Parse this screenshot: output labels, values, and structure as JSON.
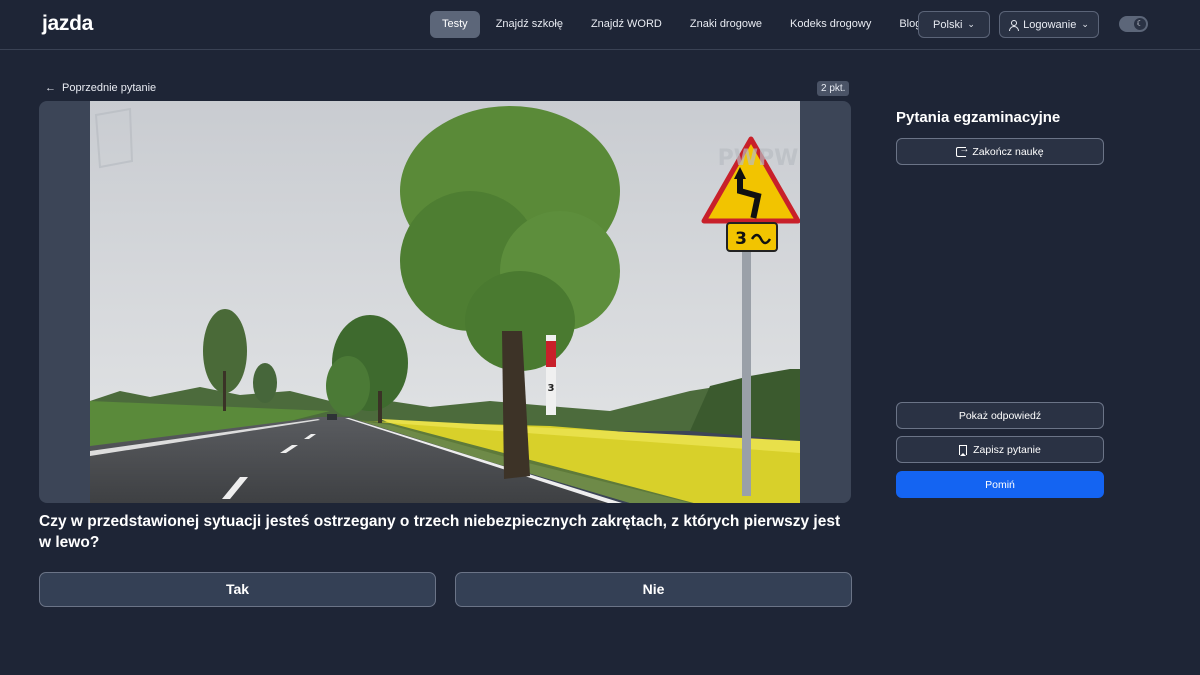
{
  "header": {
    "logo": "jazda",
    "nav": [
      {
        "label": "Testy",
        "active": true
      },
      {
        "label": "Znajdź szkołę",
        "active": false
      },
      {
        "label": "Znajdź WORD",
        "active": false
      },
      {
        "label": "Znaki drogowe",
        "active": false
      },
      {
        "label": "Kodeks drogowy",
        "active": false
      },
      {
        "label": "Blog",
        "active": false
      }
    ],
    "language": "Polski",
    "login": "Logowanie",
    "theme_icon": "moon-icon"
  },
  "main": {
    "prev_question": "Poprzednie pytanie",
    "points": "2 pkt.",
    "sign_label": "3",
    "post_label": "3",
    "watermark_left": "PWPW",
    "question": "Czy w przedstawionej sytuacji jesteś ostrzegany o trzech niebezpiecznych zakrętach, z których pierwszy jest w lewo?",
    "answers": [
      {
        "label": "Tak"
      },
      {
        "label": "Nie"
      }
    ]
  },
  "sidebar": {
    "title": "Pytania egzaminacyjne",
    "finish": "Zakończ naukę",
    "show_answer": "Pokaż odpowiedź",
    "save_question": "Zapisz pytanie",
    "skip": "Pomiń"
  },
  "colors": {
    "background": "#1e2536",
    "accent": "#1464f2",
    "logo_accent": "#4f7df5"
  }
}
